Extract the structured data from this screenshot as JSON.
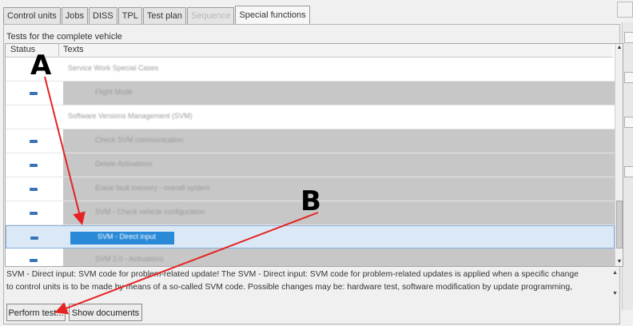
{
  "tabs": [
    {
      "label": "Control units",
      "state": "normal"
    },
    {
      "label": "Jobs",
      "state": "normal"
    },
    {
      "label": "DISS",
      "state": "normal"
    },
    {
      "label": "TPL",
      "state": "normal"
    },
    {
      "label": "Test plan",
      "state": "normal"
    },
    {
      "label": "Sequence",
      "state": "disabled"
    },
    {
      "label": "Special functions",
      "state": "active"
    }
  ],
  "panel": {
    "title": "Tests for the complete vehicle"
  },
  "grid": {
    "columns": [
      "Status",
      "Texts"
    ],
    "rows": [
      {
        "type": "group",
        "label": "Service Work Special Cases",
        "status": false,
        "selected": false
      },
      {
        "type": "item",
        "label": "Flight Mode",
        "status": true,
        "selected": false
      },
      {
        "type": "group",
        "label": "Software Versions Management (SVM)",
        "status": false,
        "selected": false
      },
      {
        "type": "item",
        "label": "Check SVM communication",
        "status": true,
        "selected": false
      },
      {
        "type": "item",
        "label": "Delete Activations",
        "status": true,
        "selected": false
      },
      {
        "type": "item",
        "label": "Erase fault memory - overall system",
        "status": true,
        "selected": false
      },
      {
        "type": "item",
        "label": "SVM - Check vehicle configuration",
        "status": true,
        "selected": false
      },
      {
        "type": "item",
        "label": "SVM - Direct input",
        "status": true,
        "selected": true
      },
      {
        "type": "item",
        "label": "SVM 2.0 - Activations",
        "status": true,
        "selected": false
      }
    ]
  },
  "description": {
    "line1": "SVM - Direct input: SVM code for problem-related update! The SVM - Direct input: SVM code for problem-related updates is applied when a specific change",
    "line2": "to control units is to be made by means of a so-called SVM code. Possible changes may be: hardware test, software modification by update programming,"
  },
  "buttons": {
    "perform_test": "Perform test...",
    "show_documents": "Show documents"
  },
  "annotations": {
    "a": "A",
    "b": "B",
    "arrow_color": "#e52323"
  },
  "icons": {
    "status": "status-icon"
  }
}
